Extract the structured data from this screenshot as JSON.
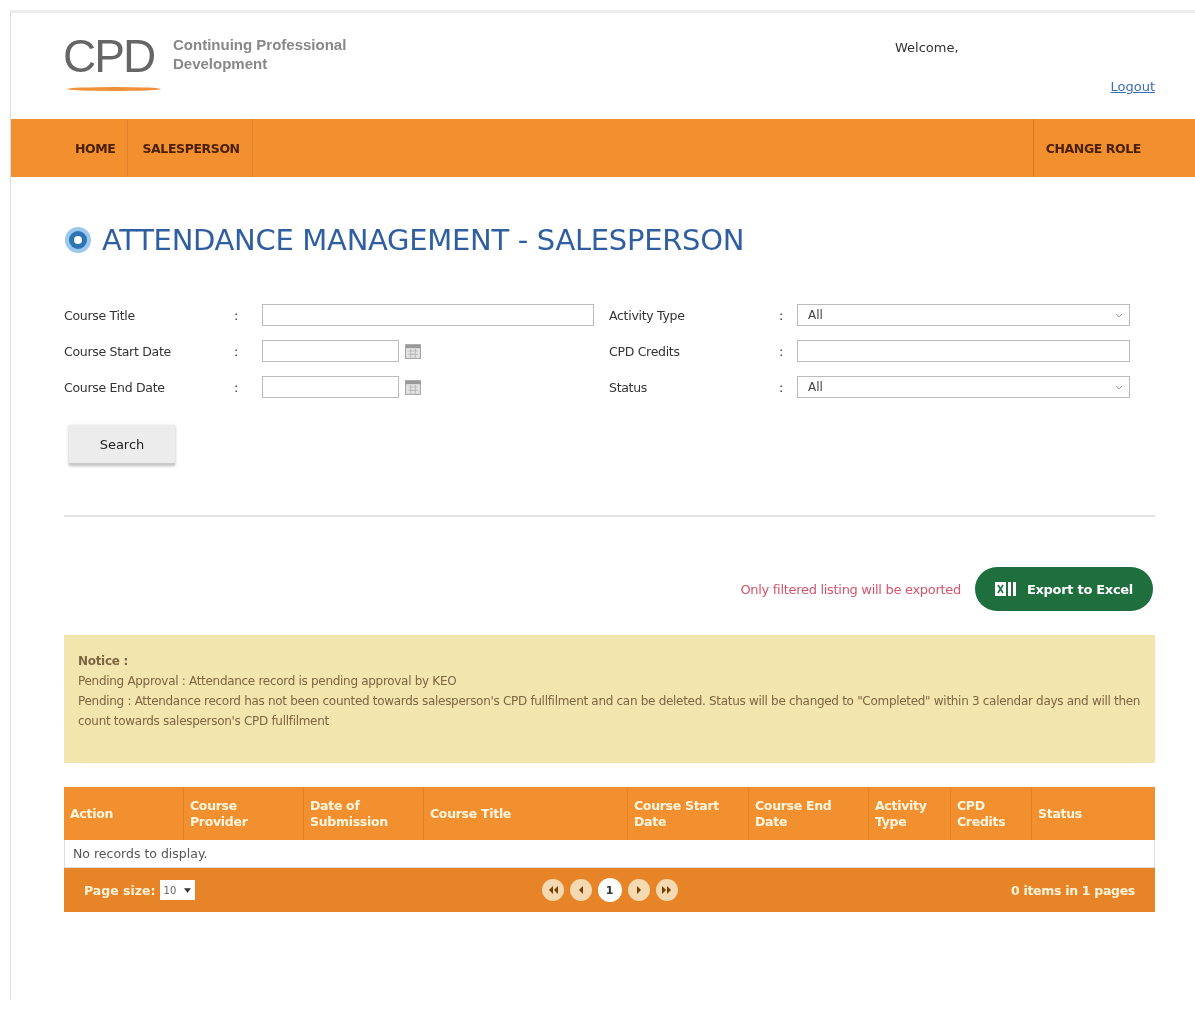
{
  "header": {
    "logo": "CPD",
    "tagline_1": "Continuing Professional",
    "tagline_2": "Development",
    "welcome": "Welcome,",
    "logout": "Logout"
  },
  "nav": {
    "left": [
      "HOME",
      "SALESPERSON"
    ],
    "right": [
      "CHANGE ROLE"
    ]
  },
  "page_title": "ATTENDANCE MANAGEMENT - SALESPERSON",
  "filters": [
    {
      "label": "Course Title",
      "kind": "text"
    },
    {
      "label": "Activity Type",
      "kind": "select",
      "value": "All"
    },
    {
      "label": "Course Start Date",
      "kind": "date"
    },
    {
      "label": "CPD Credits",
      "kind": "text"
    },
    {
      "label": "Course End Date",
      "kind": "date"
    },
    {
      "label": "Status",
      "kind": "select",
      "value": "All"
    }
  ],
  "separator": ":",
  "search_button": "Search",
  "export_note": "Only filtered listing will be exported",
  "export_button": "Export to Excel",
  "notice": {
    "title": "Notice :",
    "lines": [
      "Pending Approval : Attendance record is pending approval by KEO",
      "Pending : Attendance record has not been counted towards salesperson's CPD fullfilment and can be deleted. Status will be changed to \"Completed\" within 3 calendar days and will then count towards salesperson's CPD fullfilment"
    ]
  },
  "table": {
    "columns": [
      "Action",
      "Course Provider",
      "Date of Submission",
      "Course Title",
      "Course Start Date",
      "Course End Date",
      "Activity Type",
      "CPD Credits",
      "Status"
    ],
    "empty": "No records to display."
  },
  "pager": {
    "page_size_label": "Page size:",
    "page_size": "10",
    "pages": [
      {
        "label": "1",
        "selected": true
      }
    ],
    "summary": "0 items in 1 pages"
  }
}
